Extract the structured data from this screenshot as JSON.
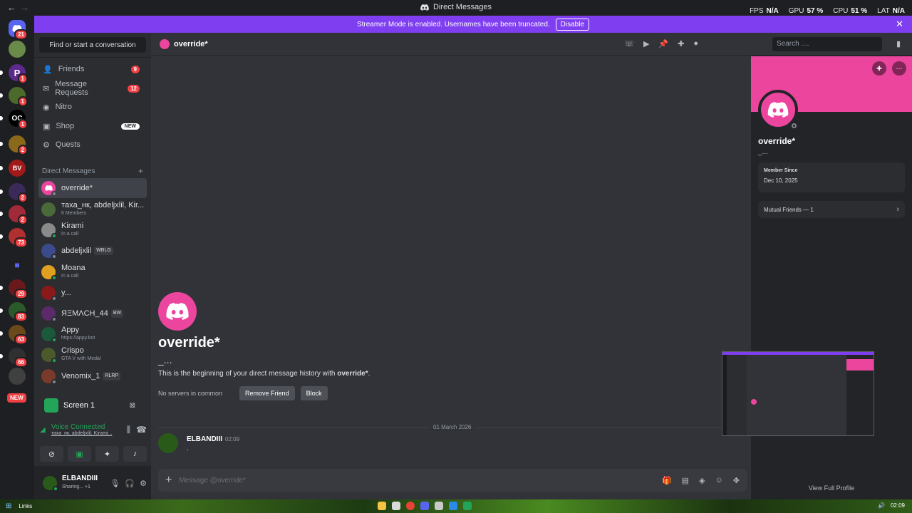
{
  "window": {
    "title": "Direct Messages",
    "back": "←",
    "forward": "→"
  },
  "stats": [
    {
      "label": "FPS",
      "value": "N/A"
    },
    {
      "label": "GPU",
      "value": "57 %"
    },
    {
      "label": "CPU",
      "value": "51 %"
    },
    {
      "label": "LAT",
      "value": "N/A"
    }
  ],
  "banner": {
    "text": "Streamer Mode is enabled. Usernames have been truncated.",
    "button": "Disable"
  },
  "rail": {
    "badges": [
      "21",
      "",
      "1",
      "1",
      "1",
      "",
      "2",
      "",
      "2",
      "2",
      "",
      "73",
      "",
      "29",
      "83",
      "63",
      "66"
    ],
    "new_label": "NEW"
  },
  "sidebar": {
    "find": "Find or start a conversation",
    "nav": [
      {
        "label": "Friends",
        "count": "9"
      },
      {
        "label": "Message Requests",
        "count": "12"
      },
      {
        "label": "Nitro",
        "count": ""
      },
      {
        "label": "Shop",
        "tag": "NEW"
      },
      {
        "label": "Quests",
        "count": ""
      }
    ],
    "dm_header": "Direct Messages",
    "dm_add": "+",
    "dms": [
      {
        "name": "override*",
        "sub": "",
        "tag": ""
      },
      {
        "name": "тaxa_нк, аbdеlјхlil, Kir...",
        "sub": "6 Members",
        "tag": ""
      },
      {
        "name": "Kirami",
        "sub": "In a call",
        "tag": ""
      },
      {
        "name": "аbdеlјхlil",
        "sub": "",
        "tag": "WBLG"
      },
      {
        "name": "Moana",
        "sub": "In a call",
        "tag": ""
      },
      {
        "name": "y...",
        "sub": "",
        "tag": ""
      },
      {
        "name": "ЯΞΜΛCΗ_44",
        "sub": "",
        "tag": "BW"
      },
      {
        "name": "Appy",
        "sub": "https://appy.bot",
        "tag": ""
      },
      {
        "name": "Crispo",
        "sub": "GTA V with Medal",
        "tag": ""
      },
      {
        "name": "Venomix_1",
        "sub": "",
        "tag": "RLRP"
      }
    ]
  },
  "screen_panel": {
    "title": "Screen 1"
  },
  "voice": {
    "status": "Voice Connected",
    "channel": "тaxa_нк, аbdеlјхlil, Kirami..."
  },
  "user": {
    "name": "ELBANDIII",
    "status": "Sharing... +1"
  },
  "header": {
    "name": "override*",
    "search_placeholder": "Search ...."
  },
  "welcome": {
    "name": "override*",
    "username": "_...",
    "desc_pre": "This is the beginning of your direct message history with ",
    "desc_name": "override*",
    "desc_post": ".",
    "no_servers": "No servers in common",
    "remove": "Remove Friend",
    "block": "Block"
  },
  "divider_date": "01 March 2026",
  "message": {
    "author": "ELBANDIII",
    "time": "02:09",
    "text": "."
  },
  "composer": {
    "placeholder": "Message @override*"
  },
  "profile": {
    "name": "override*",
    "username": "_...",
    "member_since_label": "Member Since",
    "member_since": "Dec 10, 2025",
    "mutual": "Mutual Friends — 1",
    "view_full": "View Full Profile"
  },
  "taskbar": {
    "links": "Links",
    "time": "02:09"
  },
  "colors": {
    "accent": "#eb459e",
    "banner": "#7f3ef0",
    "online": "#23a559",
    "danger": "#f23f43"
  }
}
